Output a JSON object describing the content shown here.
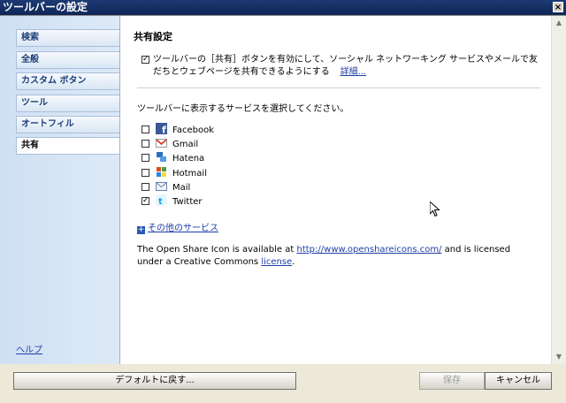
{
  "window": {
    "title": "ツールバーの設定",
    "close_glyph": "×"
  },
  "sidebar": {
    "items": [
      {
        "label": "検索"
      },
      {
        "label": "全般"
      },
      {
        "label": "カスタム ボタン"
      },
      {
        "label": "ツール"
      },
      {
        "label": "オートフィル"
      },
      {
        "label": "共有",
        "active": true
      }
    ],
    "help": "ヘルプ"
  },
  "main": {
    "title": "共有設定",
    "enable": {
      "checked": true,
      "text": "ツールバーの［共有］ボタンを有効にして、ソーシャル ネットワーキング サービスやメールで友だちとウェブページを共有できるようにする",
      "link": "詳細..."
    },
    "select_text": "ツールバーに表示するサービスを選択してください。",
    "services": [
      {
        "label": "Facebook",
        "icon": "facebook-icon",
        "checked": false
      },
      {
        "label": "Gmail",
        "icon": "gmail-icon",
        "checked": false
      },
      {
        "label": "Hatena",
        "icon": "hatena-icon",
        "checked": false
      },
      {
        "label": "Hotmail",
        "icon": "hotmail-icon",
        "checked": false
      },
      {
        "label": "Mail",
        "icon": "mail-icon",
        "checked": false
      },
      {
        "label": "Twitter",
        "icon": "twitter-icon",
        "checked": true
      }
    ],
    "more_services": "その他のサービス",
    "license": {
      "part1": "The Open Share Icon is available at ",
      "url": "http://www.openshareicons.com/",
      "part2": " and is licensed under a Creative Commons ",
      "link": "license",
      "part3": "."
    }
  },
  "footer": {
    "reset_label": "デフォルトに戻す...",
    "save_label": "保存",
    "cancel_label": "キャンセル"
  },
  "colors": {
    "accent": "#1f3ea8",
    "titlebar": "#1d3a74",
    "sidebar": "#d6e4f4"
  }
}
